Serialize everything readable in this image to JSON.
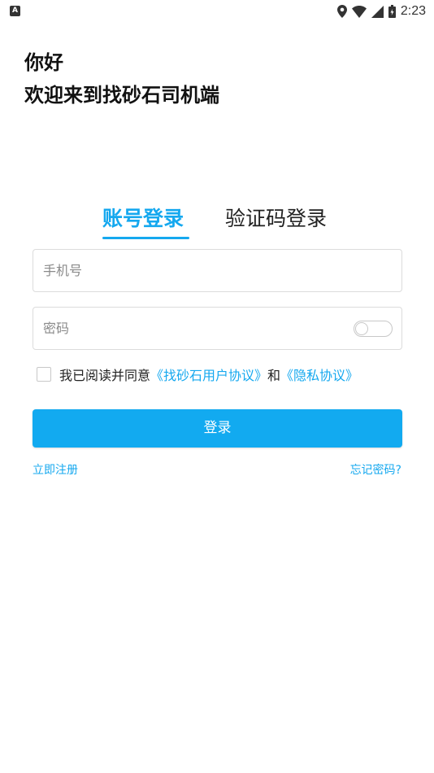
{
  "status_bar": {
    "notification_icon": "A",
    "time": "2:23",
    "icons": [
      "location-icon",
      "wifi-icon",
      "signal-icon",
      "battery-icon"
    ]
  },
  "greeting": {
    "line1": "你好",
    "line2": "欢迎来到找砂石司机端"
  },
  "tabs": [
    {
      "label": "账号登录",
      "active": true
    },
    {
      "label": "验证码登录",
      "active": false
    }
  ],
  "form": {
    "phone_placeholder": "手机号",
    "password_placeholder": "密码"
  },
  "agreement": {
    "prefix": "我已阅读并同意",
    "user_agreement": "《找砂石用户协议》",
    "and": "和",
    "privacy_agreement": "《隐私协议》"
  },
  "login_label": "登录",
  "links": {
    "register": "立即注册",
    "forgot": "忘记密码?"
  },
  "colors": {
    "accent": "#15a8ef",
    "button": "#12aaf0"
  }
}
